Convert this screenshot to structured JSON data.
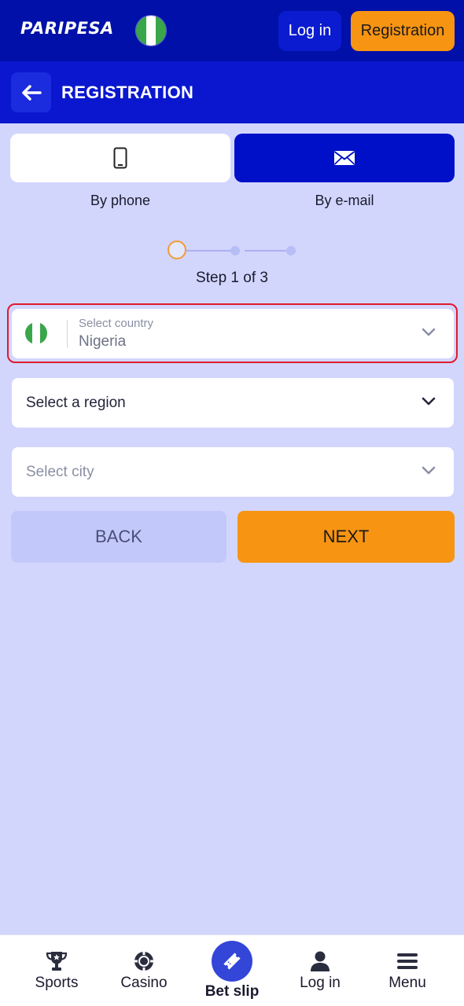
{
  "topbar": {
    "logo": "PARIPESA",
    "login_label": "Log in",
    "register_label": "Registration"
  },
  "header": {
    "title": "REGISTRATION"
  },
  "tabs": [
    {
      "label": "By phone",
      "icon": "phone-icon",
      "active": false
    },
    {
      "label": "By e-mail",
      "icon": "envelope-icon",
      "active": true
    }
  ],
  "stepper": {
    "text": "Step 1 of 3",
    "current": 1,
    "total": 3
  },
  "form": {
    "country": {
      "label": "Select country",
      "value": "Nigeria"
    },
    "region": {
      "placeholder": "Select a region"
    },
    "city": {
      "placeholder": "Select city"
    }
  },
  "actions": {
    "back_label": "BACK",
    "next_label": "NEXT"
  },
  "bottom_nav": {
    "items": [
      {
        "label": "Sports",
        "icon": "trophy-icon"
      },
      {
        "label": "Casino",
        "icon": "casino-chip-icon"
      },
      {
        "label": "Bet slip",
        "icon": "ticket-icon"
      },
      {
        "label": "Log in",
        "icon": "user-icon"
      },
      {
        "label": "Menu",
        "icon": "hamburger-icon"
      }
    ]
  },
  "colors": {
    "brand_dark": "#0010a8",
    "brand": "#0a17cf",
    "accent_orange": "#f79412",
    "background": "#d2d6fd",
    "error_outline": "#e0192d"
  }
}
